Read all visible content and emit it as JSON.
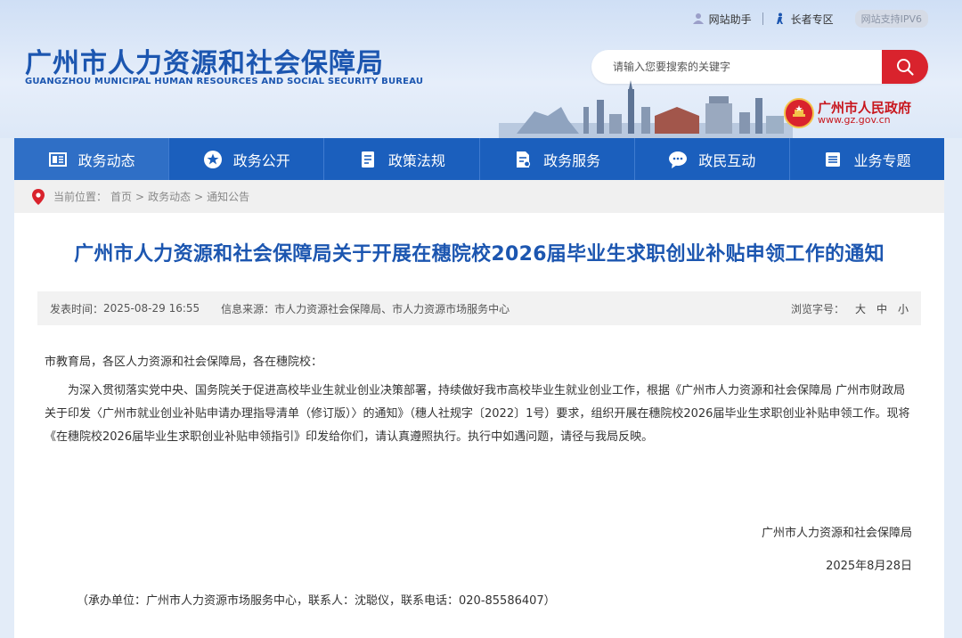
{
  "header": {
    "top_links": {
      "assistant": "网站助手",
      "elder": "长者专区",
      "ipv6": "网站支持IPV6"
    },
    "logo_cn": "广州市人力资源和社会保障局",
    "logo_en": "GUANGZHOU MUNICIPAL HUMAN RESOURCES AND SOCIAL SECURITY BUREAU",
    "search_placeholder": "请输入您要搜索的关键字",
    "gov_name": "广州市人民政府",
    "gov_url": "www.gz.gov.cn"
  },
  "nav": {
    "items": [
      {
        "label": "政务动态",
        "icon": "newspaper-icon"
      },
      {
        "label": "政务公开",
        "icon": "star-circle-icon"
      },
      {
        "label": "政策法规",
        "icon": "document-icon"
      },
      {
        "label": "政务服务",
        "icon": "service-doc-icon"
      },
      {
        "label": "政民互动",
        "icon": "chat-icon"
      },
      {
        "label": "业务专题",
        "icon": "list-icon"
      }
    ]
  },
  "breadcrumb": {
    "prefix": "当前位置：",
    "home": "首页",
    "sep": ">",
    "level1": "政务动态",
    "level2": "通知公告"
  },
  "article": {
    "title": "广州市人力资源和社会保障局关于开展在穗院校2026届毕业生求职创业补贴申领工作的通知",
    "publish_label": "发表时间：",
    "publish_time": "2025-08-29 16:55",
    "source_label": "信息来源：",
    "source": "市人力资源社会保障局、市人力资源市场服务中心",
    "font_label": "浏览字号：",
    "font_large": "大",
    "font_medium": "中",
    "font_small": "小",
    "salutation": "市教育局，各区人力资源和社会保障局，各在穗院校：",
    "paragraph": "为深入贯彻落实党中央、国务院关于促进高校毕业生就业创业决策部署，持续做好我市高校毕业生就业创业工作，根据《广州市人力资源和社会保障局 广州市财政局关于印发〈广州市就业创业补贴申请办理指导清单（修订版）〉的通知》（穗人社规字〔2022〕1号）要求，组织开展在穗院校2026届毕业生求职创业补贴申领工作。现将《在穗院校2026届毕业生求职创业补贴申领指引》印发给你们，请认真遵照执行。执行中如遇问题，请径与我局反映。",
    "signature": "广州市人力资源和社会保障局",
    "date": "2025年8月28日",
    "contact": "（承办单位：广州市人力资源市场服务中心，联系人：沈聪仪，联系电话：020-85586407）"
  },
  "colors": {
    "brand_blue": "#1c56b0",
    "nav_blue": "#1b5fbd",
    "accent_red": "#d9232d"
  }
}
